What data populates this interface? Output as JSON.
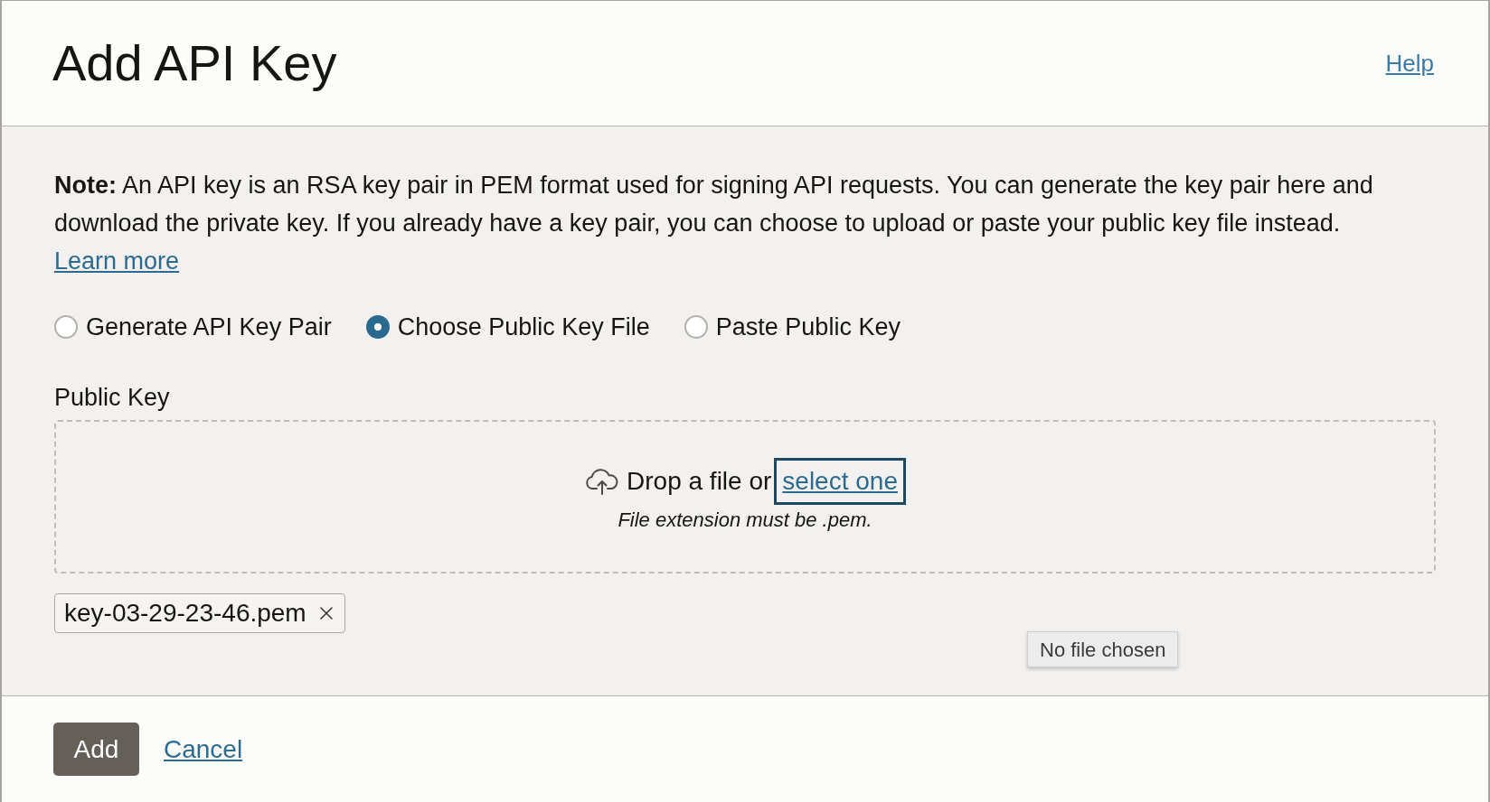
{
  "dialog": {
    "title": "Add API Key",
    "help_link": "Help"
  },
  "note": {
    "text": "**Note:** An API key is an RSA key pair in PEM format used for signing API requests. You can generate the key pair here and download the private key. If you already have a key pair, you can choose to upload or paste your public key file instead.",
    "link": "Learn more"
  },
  "key_options": [
    {
      "label": "Generate API Key Pair",
      "selected": false
    },
    {
      "label": "Choose Public Key File",
      "selected": true
    },
    {
      "label": "Paste Public Key",
      "selected": false
    }
  ],
  "public_key": {
    "label": "Public Key",
    "drop_text": "Drop a file or",
    "select_link": {
      "label": "select one",
      "focused": true
    },
    "hint": "File extension must be .pem.",
    "files": [
      {
        "name": "key-03-29-23-46.pem"
      }
    ]
  },
  "tooltip": "No file chosen",
  "buttons": [
    {
      "label": "Add",
      "kind": "primary"
    },
    {
      "label": "Cancel",
      "kind": "link"
    }
  ]
}
